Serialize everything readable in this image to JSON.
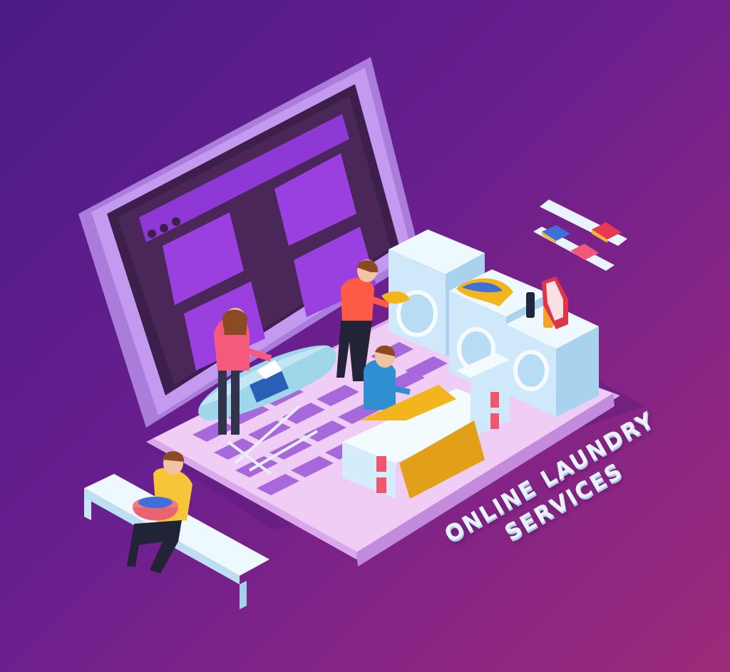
{
  "headline": {
    "line1": "ONLINE LAUNDRY",
    "line2": "SERVICES"
  },
  "colors": {
    "background_start": "#4a1a86",
    "background_end": "#9c2a79",
    "laptop_frame": "#b98be6",
    "laptop_screen": "#4a2758",
    "screen_tiles": "#9a3fe0",
    "keyboard_deck": "#eec6f2",
    "washer_body": "#dff2ff",
    "cloth_yellow": "#f0b51c",
    "ironing_board": "#9fd6ea"
  },
  "icons": [
    "laptop-icon",
    "washing-machine-icon",
    "ironing-board-icon",
    "bench-icon",
    "shelf-icon",
    "detergent-bottle-icon",
    "laundry-basket-icon"
  ]
}
